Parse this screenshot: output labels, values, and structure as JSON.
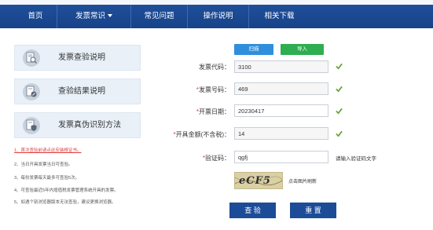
{
  "nav": {
    "items": [
      {
        "label": "首页"
      },
      {
        "label": "发票常识"
      },
      {
        "label": "常见问题"
      },
      {
        "label": "操作说明"
      },
      {
        "label": "相关下载"
      }
    ]
  },
  "sidebar": {
    "cards": [
      {
        "label": "发票查验说明",
        "icon": "magnifier-document-icon"
      },
      {
        "label": "查验结果说明",
        "icon": "pencil-document-icon"
      },
      {
        "label": "发票真伪识别方法",
        "icon": "shield-document-icon"
      }
    ],
    "notes": [
      "1、首次查验前请点此安装根证书。",
      "2、当日开具发票当日可查验。",
      "3、每份发票每天最多可查验5次。",
      "4、可查验最近5年内增值税发票管理系统开具的发票。",
      "5、如遇个别浏览器版本无法查验，建议更换浏览器。"
    ]
  },
  "toolbar": {
    "scan_label": "扫描",
    "import_label": "导入"
  },
  "form": {
    "invoice_code": {
      "label": "发票代码：",
      "value": "3100"
    },
    "invoice_number": {
      "label": "发票号码：",
      "value": "469"
    },
    "issue_date": {
      "label": "开票日期：",
      "value": "20230417"
    },
    "amount": {
      "label": "开具金额(不含税)：",
      "value": "14"
    },
    "captcha": {
      "label": "验证码：",
      "value": "qgfj",
      "hint": "请输入验证码文字"
    },
    "captcha_image_text": "eCF5",
    "refresh_label": "点击图片刷新",
    "required_mark": "*"
  },
  "actions": {
    "check_label": "查 验",
    "reset_label": "重 置"
  },
  "colors": {
    "nav_bg": "#1f4f9a",
    "check_green": "#6aa33a",
    "required_red": "#e03b3b",
    "button_blue": "#1c4c98",
    "scan_blue": "#2f8fdd",
    "import_green": "#2eae50"
  }
}
